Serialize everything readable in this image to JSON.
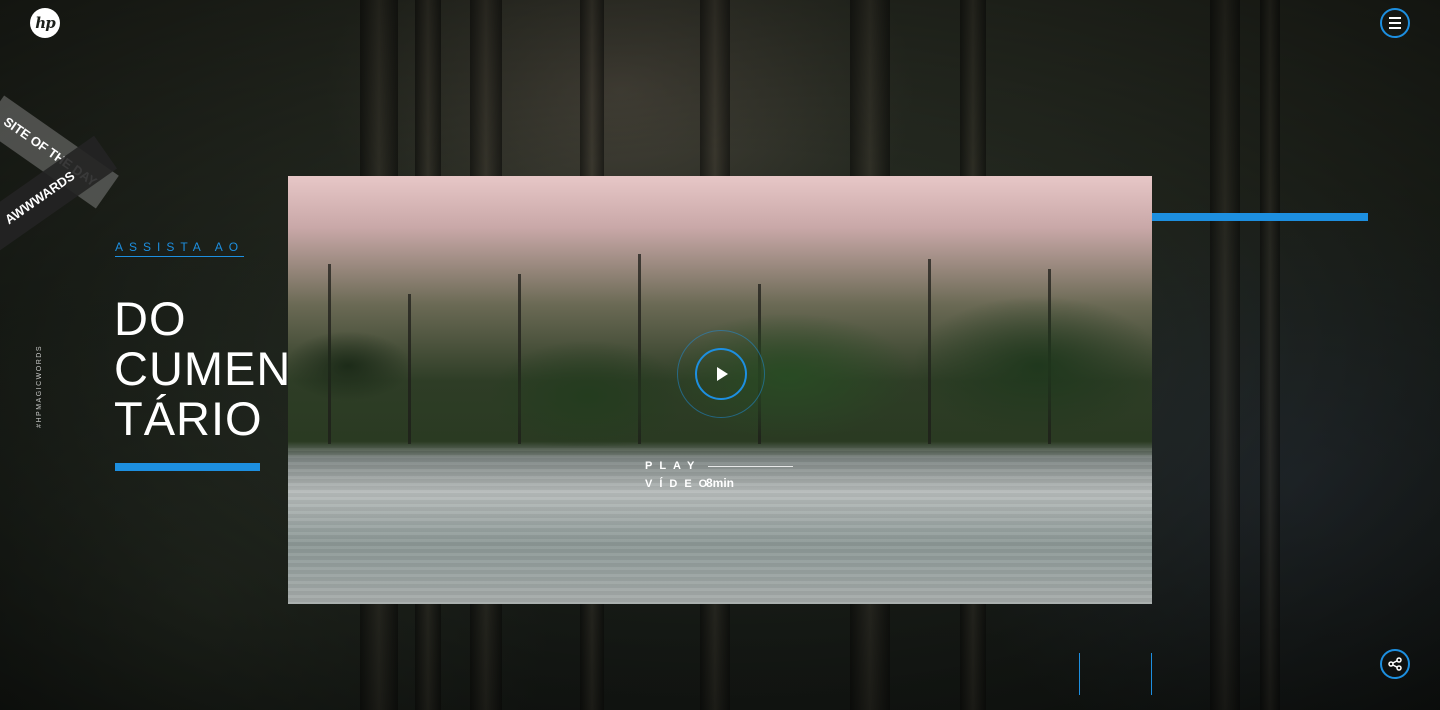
{
  "brand": {
    "logo_text": "hp"
  },
  "header": {
    "menu_icon": "hamburger-icon"
  },
  "ribbon": {
    "top_text": "SITE OF THE DAY",
    "bottom_text": "AWWWARDS"
  },
  "side_tag": "#HPMAGICWORDS",
  "hero": {
    "kicker": "ASSISTA AO",
    "headline_lines": [
      "DO",
      "CUMEN",
      "TÁRIO"
    ]
  },
  "video": {
    "play_line1": "PLAY",
    "play_line2": "VÍDEO",
    "duration": "8min",
    "play_icon": "play-icon"
  },
  "footer": {
    "share_icon": "share-icon"
  },
  "colors": {
    "accent": "#1d8fe0",
    "text": "#ffffff"
  }
}
